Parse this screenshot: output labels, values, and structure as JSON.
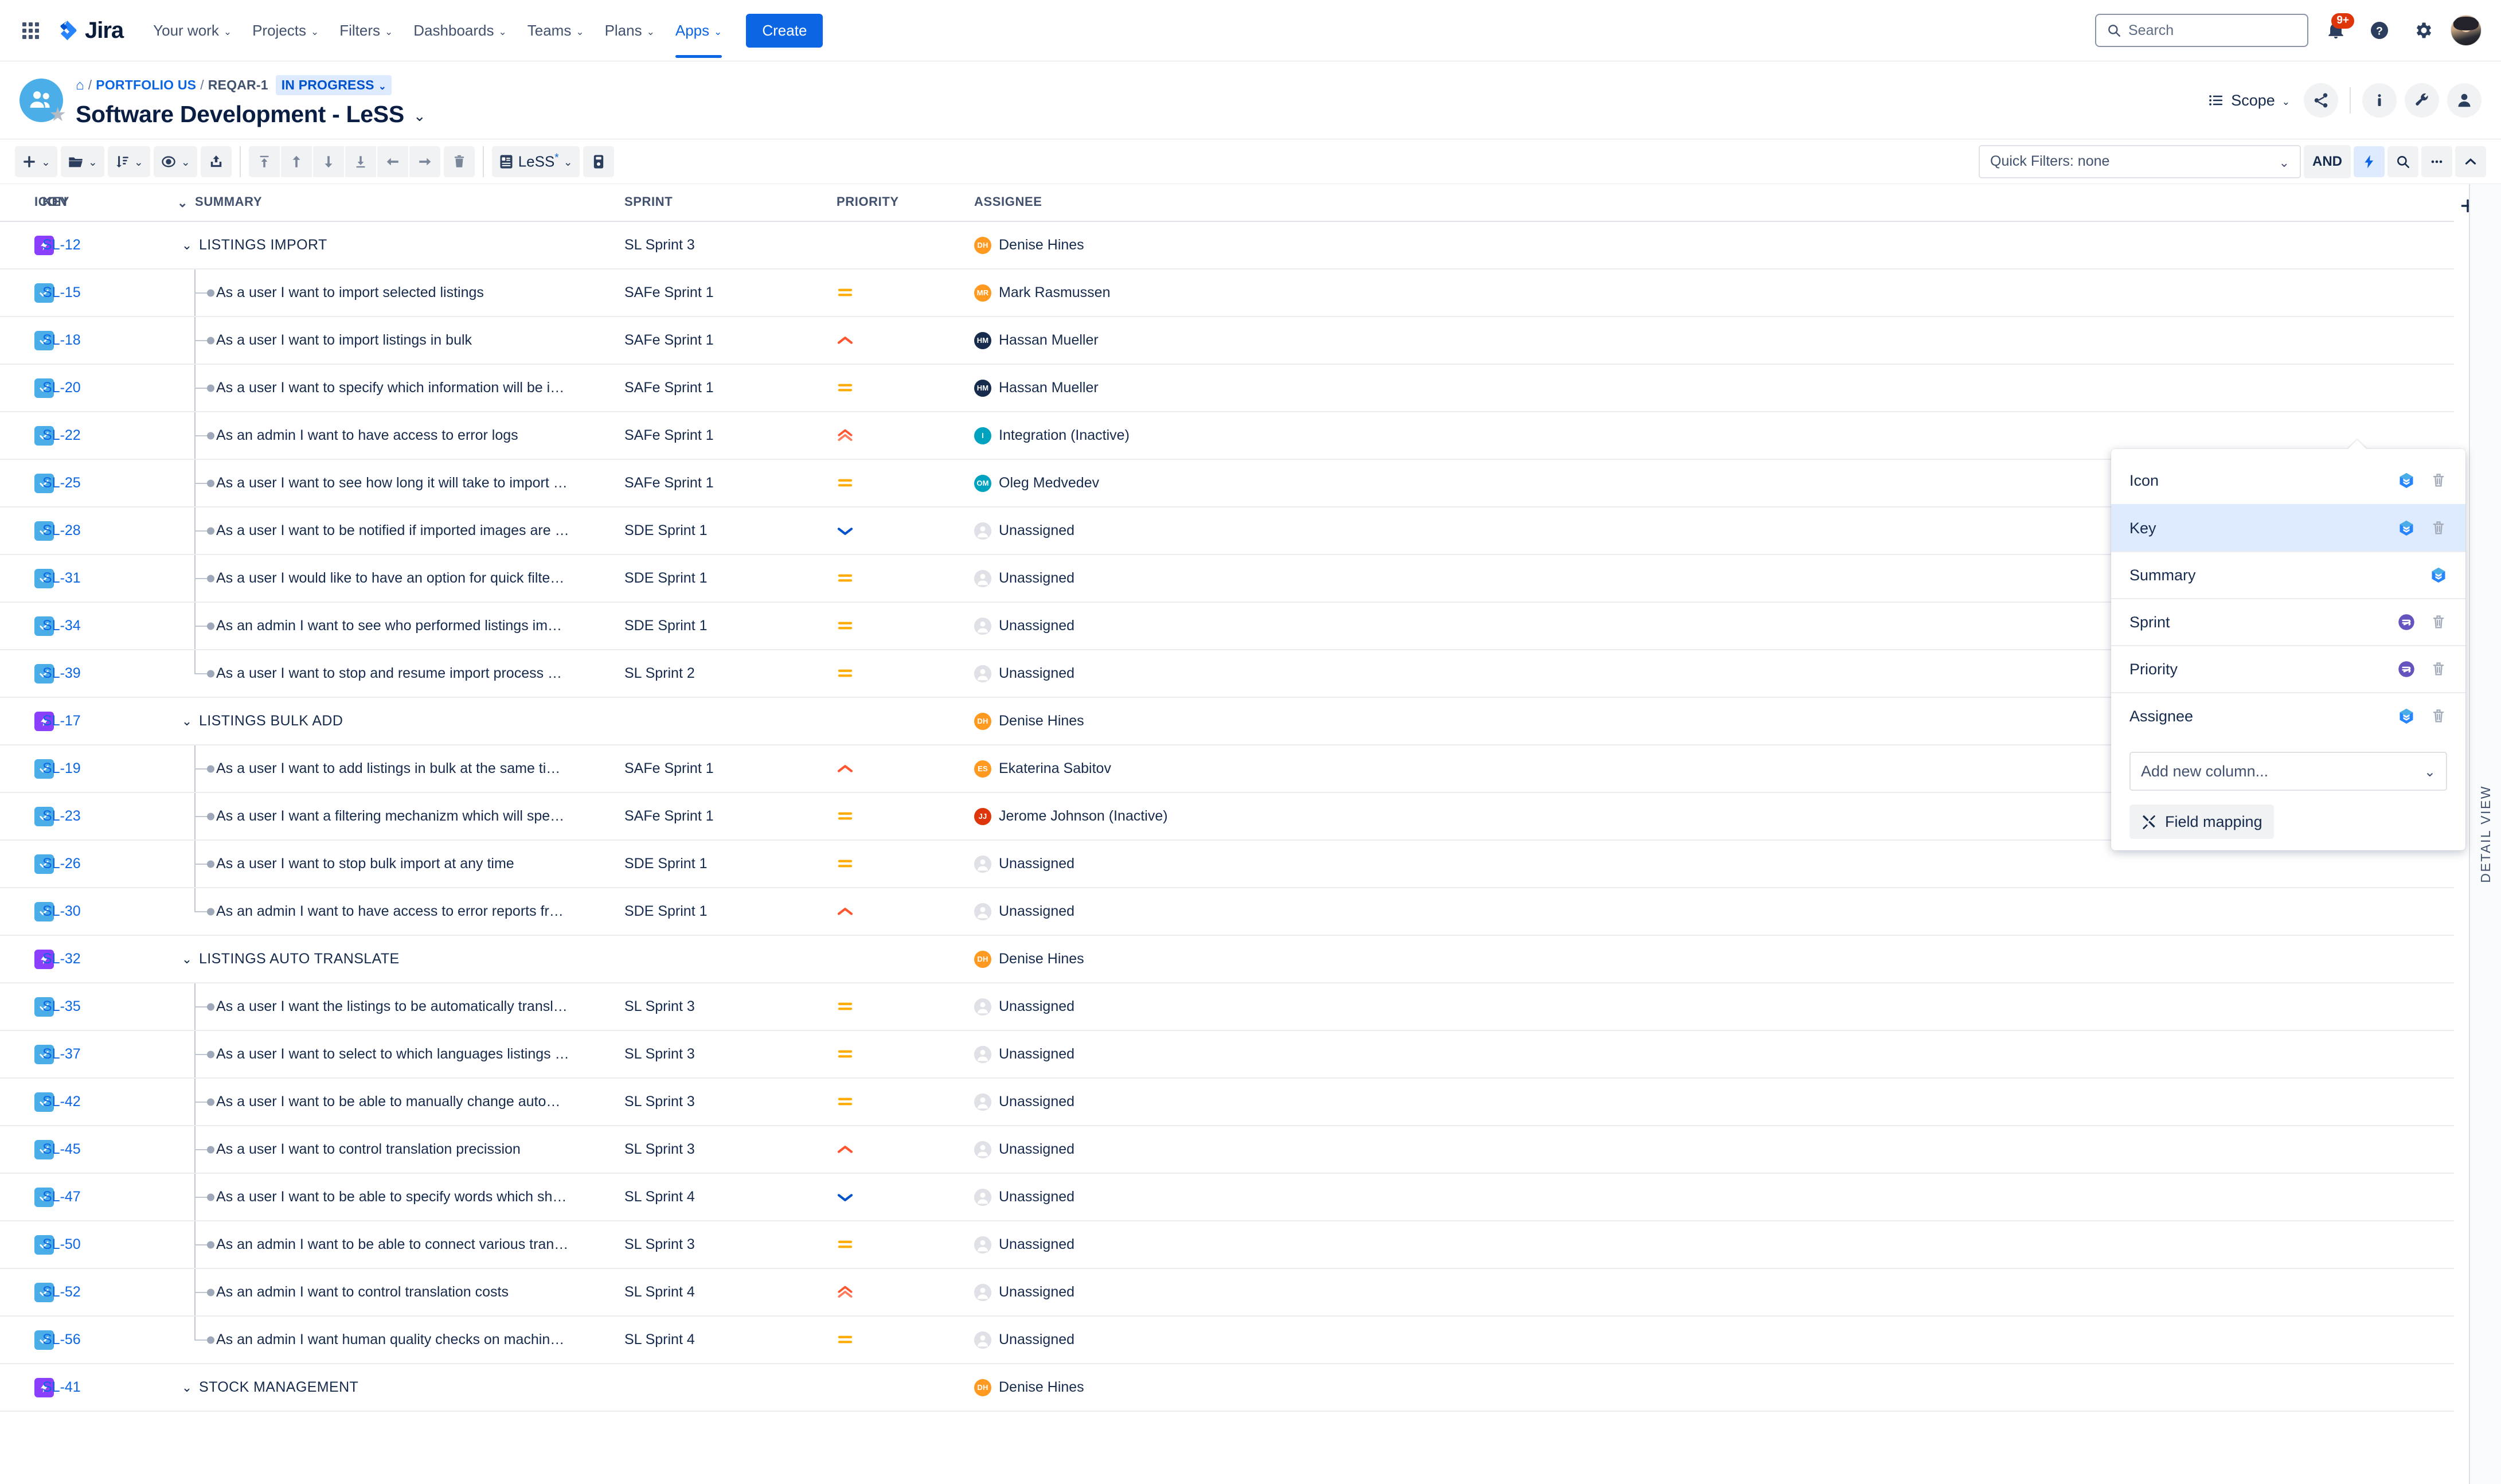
{
  "topnav": {
    "brand": "Jira",
    "items": [
      {
        "label": "Your work",
        "caret": true,
        "active": false
      },
      {
        "label": "Projects",
        "caret": true,
        "active": false
      },
      {
        "label": "Filters",
        "caret": true,
        "active": false
      },
      {
        "label": "Dashboards",
        "caret": true,
        "active": false
      },
      {
        "label": "Teams",
        "caret": true,
        "active": false
      },
      {
        "label": "Plans",
        "caret": true,
        "active": false
      },
      {
        "label": "Apps",
        "caret": true,
        "active": true
      }
    ],
    "create_label": "Create",
    "search_placeholder": "Search",
    "notification_badge": "9+"
  },
  "header": {
    "breadcrumb": {
      "home": "home-icon",
      "project": "PORTFOLIO US",
      "issue": "REQAR-1",
      "status": "IN PROGRESS"
    },
    "title": "Software Development - LeSS",
    "scope_label": "Scope"
  },
  "toolbar": {
    "less_label": "LeSS",
    "less_star": "*",
    "quick_filters": "Quick Filters: none",
    "and_label": "AND"
  },
  "table": {
    "columns": [
      "ICON",
      "KEY",
      "SUMMARY",
      "SPRINT",
      "PRIORITY",
      "ASSIGNEE"
    ],
    "rows": [
      {
        "type": "epic",
        "icon": "epic-icon",
        "key": "SL-12",
        "summary": "LISTINGS IMPORT",
        "sprint": "SL Sprint 3",
        "priority": "",
        "assignee": "Denise Hines",
        "initials": "DH",
        "avatar_color": "#FF991F"
      },
      {
        "type": "story",
        "icon": "story-icon",
        "key": "SL-15",
        "summary": "As a user I want to import selected listings",
        "sprint": "SAFe Sprint 1",
        "priority": "medium",
        "assignee": "Mark Rasmussen",
        "initials": "MR",
        "avatar_color": "#FF991F"
      },
      {
        "type": "story",
        "icon": "story-icon",
        "key": "SL-18",
        "summary": "As a user I want to import listings in bulk",
        "sprint": "SAFe Sprint 1",
        "priority": "high",
        "assignee": "Hassan Mueller",
        "initials": "HM",
        "avatar_color": "#172B4D"
      },
      {
        "type": "story",
        "icon": "story-icon",
        "key": "SL-20",
        "summary": "As a user I want to specify which information will be i…",
        "sprint": "SAFe Sprint 1",
        "priority": "medium",
        "assignee": "Hassan Mueller",
        "initials": "HM",
        "avatar_color": "#172B4D"
      },
      {
        "type": "story",
        "icon": "story-icon",
        "key": "SL-22",
        "summary": "As an admin I want to have access to error logs",
        "sprint": "SAFe Sprint 1",
        "priority": "highest",
        "assignee": "Integration (Inactive)",
        "initials": "I",
        "avatar_color": "#00A3BF"
      },
      {
        "type": "story",
        "icon": "story-icon",
        "key": "SL-25",
        "summary": "As a user I want to see how long it will take to import …",
        "sprint": "SAFe Sprint 1",
        "priority": "medium",
        "assignee": "Oleg Medvedev",
        "initials": "OM",
        "avatar_color": "#00A3BF"
      },
      {
        "type": "story",
        "icon": "story-icon",
        "key": "SL-28",
        "summary": "As a user I want to be notified if imported images are …",
        "sprint": "SDE Sprint 1",
        "priority": "low",
        "assignee": "Unassigned",
        "initials": "",
        "avatar_color": ""
      },
      {
        "type": "story",
        "icon": "story-icon",
        "key": "SL-31",
        "summary": "As a user I would like to have an option for quick filte…",
        "sprint": "SDE Sprint 1",
        "priority": "medium",
        "assignee": "Unassigned",
        "initials": "",
        "avatar_color": ""
      },
      {
        "type": "story",
        "icon": "story-icon",
        "key": "SL-34",
        "summary": "As an admin I want to see who performed listings im…",
        "sprint": "SDE Sprint 1",
        "priority": "medium",
        "assignee": "Unassigned",
        "initials": "",
        "avatar_color": ""
      },
      {
        "type": "story",
        "icon": "story-icon",
        "key": "SL-39",
        "summary": "As a user I want to stop and resume import process …",
        "sprint": "SL Sprint 2",
        "priority": "medium",
        "assignee": "Unassigned",
        "initials": "",
        "avatar_color": "",
        "last": true
      },
      {
        "type": "epic",
        "icon": "epic-icon",
        "key": "SL-17",
        "summary": "LISTINGS BULK ADD",
        "sprint": "",
        "priority": "",
        "assignee": "Denise Hines",
        "initials": "DH",
        "avatar_color": "#FF991F"
      },
      {
        "type": "story",
        "icon": "story-icon",
        "key": "SL-19",
        "summary": "As a user I want to add listings in bulk at the same ti…",
        "sprint": "SAFe Sprint 1",
        "priority": "high",
        "assignee": "Ekaterina Sabitov",
        "initials": "ES",
        "avatar_color": "#FF991F"
      },
      {
        "type": "story",
        "icon": "story-icon",
        "key": "SL-23",
        "summary": "As a user I want a filtering mechanizm which will spe…",
        "sprint": "SAFe Sprint 1",
        "priority": "medium",
        "assignee": "Jerome Johnson (Inactive)",
        "initials": "JJ",
        "avatar_color": "#DE350B"
      },
      {
        "type": "story",
        "icon": "story-icon",
        "key": "SL-26",
        "summary": "As a user I want to stop bulk import at any time",
        "sprint": "SDE Sprint 1",
        "priority": "medium",
        "assignee": "Unassigned",
        "initials": "",
        "avatar_color": ""
      },
      {
        "type": "story",
        "icon": "story-icon",
        "key": "SL-30",
        "summary": "As an admin I want to have access to error reports fr…",
        "sprint": "SDE Sprint 1",
        "priority": "high",
        "assignee": "Unassigned",
        "initials": "",
        "avatar_color": "",
        "last": true
      },
      {
        "type": "epic",
        "icon": "epic-icon",
        "key": "SL-32",
        "summary": "LISTINGS AUTO TRANSLATE",
        "sprint": "",
        "priority": "",
        "assignee": "Denise Hines",
        "initials": "DH",
        "avatar_color": "#FF991F"
      },
      {
        "type": "story",
        "icon": "story-icon",
        "key": "SL-35",
        "summary": "As a user I want the listings to be automatically transl…",
        "sprint": "SL Sprint 3",
        "priority": "medium",
        "assignee": "Unassigned",
        "initials": "",
        "avatar_color": ""
      },
      {
        "type": "story",
        "icon": "story-icon",
        "key": "SL-37",
        "summary": "As a user I want to select to which languages listings …",
        "sprint": "SL Sprint 3",
        "priority": "medium",
        "assignee": "Unassigned",
        "initials": "",
        "avatar_color": ""
      },
      {
        "type": "story",
        "icon": "story-icon",
        "key": "SL-42",
        "summary": "As a user I want to be able to manually change auto…",
        "sprint": "SL Sprint 3",
        "priority": "medium",
        "assignee": "Unassigned",
        "initials": "",
        "avatar_color": ""
      },
      {
        "type": "story",
        "icon": "story-icon",
        "key": "SL-45",
        "summary": "As a user I want to control translation precission",
        "sprint": "SL Sprint 3",
        "priority": "high",
        "assignee": "Unassigned",
        "initials": "",
        "avatar_color": ""
      },
      {
        "type": "story",
        "icon": "story-icon",
        "key": "SL-47",
        "summary": "As a user I want to be able to specify words which sh…",
        "sprint": "SL Sprint 4",
        "priority": "low",
        "assignee": "Unassigned",
        "initials": "",
        "avatar_color": ""
      },
      {
        "type": "story",
        "icon": "story-icon",
        "key": "SL-50",
        "summary": "As an admin I want to be able to connect various tran…",
        "sprint": "SL Sprint 3",
        "priority": "medium",
        "assignee": "Unassigned",
        "initials": "",
        "avatar_color": ""
      },
      {
        "type": "story",
        "icon": "story-icon",
        "key": "SL-52",
        "summary": "As an admin I want to control translation costs",
        "sprint": "SL Sprint 4",
        "priority": "highest",
        "assignee": "Unassigned",
        "initials": "",
        "avatar_color": ""
      },
      {
        "type": "story",
        "icon": "story-icon",
        "key": "SL-56",
        "summary": "As an admin I want human quality checks on machin…",
        "sprint": "SL Sprint 4",
        "priority": "medium",
        "assignee": "Unassigned",
        "initials": "",
        "avatar_color": "",
        "last": true
      },
      {
        "type": "epic",
        "icon": "epic-icon",
        "key": "SL-41",
        "summary": "STOCK MANAGEMENT",
        "sprint": "",
        "priority": "",
        "assignee": "Denise Hines",
        "initials": "DH",
        "avatar_color": "#FF991F"
      }
    ]
  },
  "column_popup": {
    "items": [
      {
        "label": "Icon",
        "source": "jira",
        "deletable": true,
        "selected": false
      },
      {
        "label": "Key",
        "source": "jira",
        "deletable": true,
        "selected": true
      },
      {
        "label": "Summary",
        "source": "jira",
        "deletable": false,
        "selected": false
      },
      {
        "label": "Sprint",
        "source": "app",
        "deletable": true,
        "selected": false
      },
      {
        "label": "Priority",
        "source": "app",
        "deletable": true,
        "selected": false
      },
      {
        "label": "Assignee",
        "source": "jira",
        "deletable": true,
        "selected": false
      }
    ],
    "add_new_label": "Add new column...",
    "field_mapping_label": "Field mapping"
  },
  "detail_tab": {
    "label": "DETAIL VIEW"
  },
  "colors": {
    "brand_blue": "#0C66E4",
    "epic_purple": "#8A3FFC",
    "story_blue": "#4BADE8",
    "priority_medium": "#FFAB00",
    "priority_high": "#FF5630",
    "priority_highest": "#FF5630",
    "priority_low": "#0052CC",
    "selected_row": "#DEEBFF"
  }
}
